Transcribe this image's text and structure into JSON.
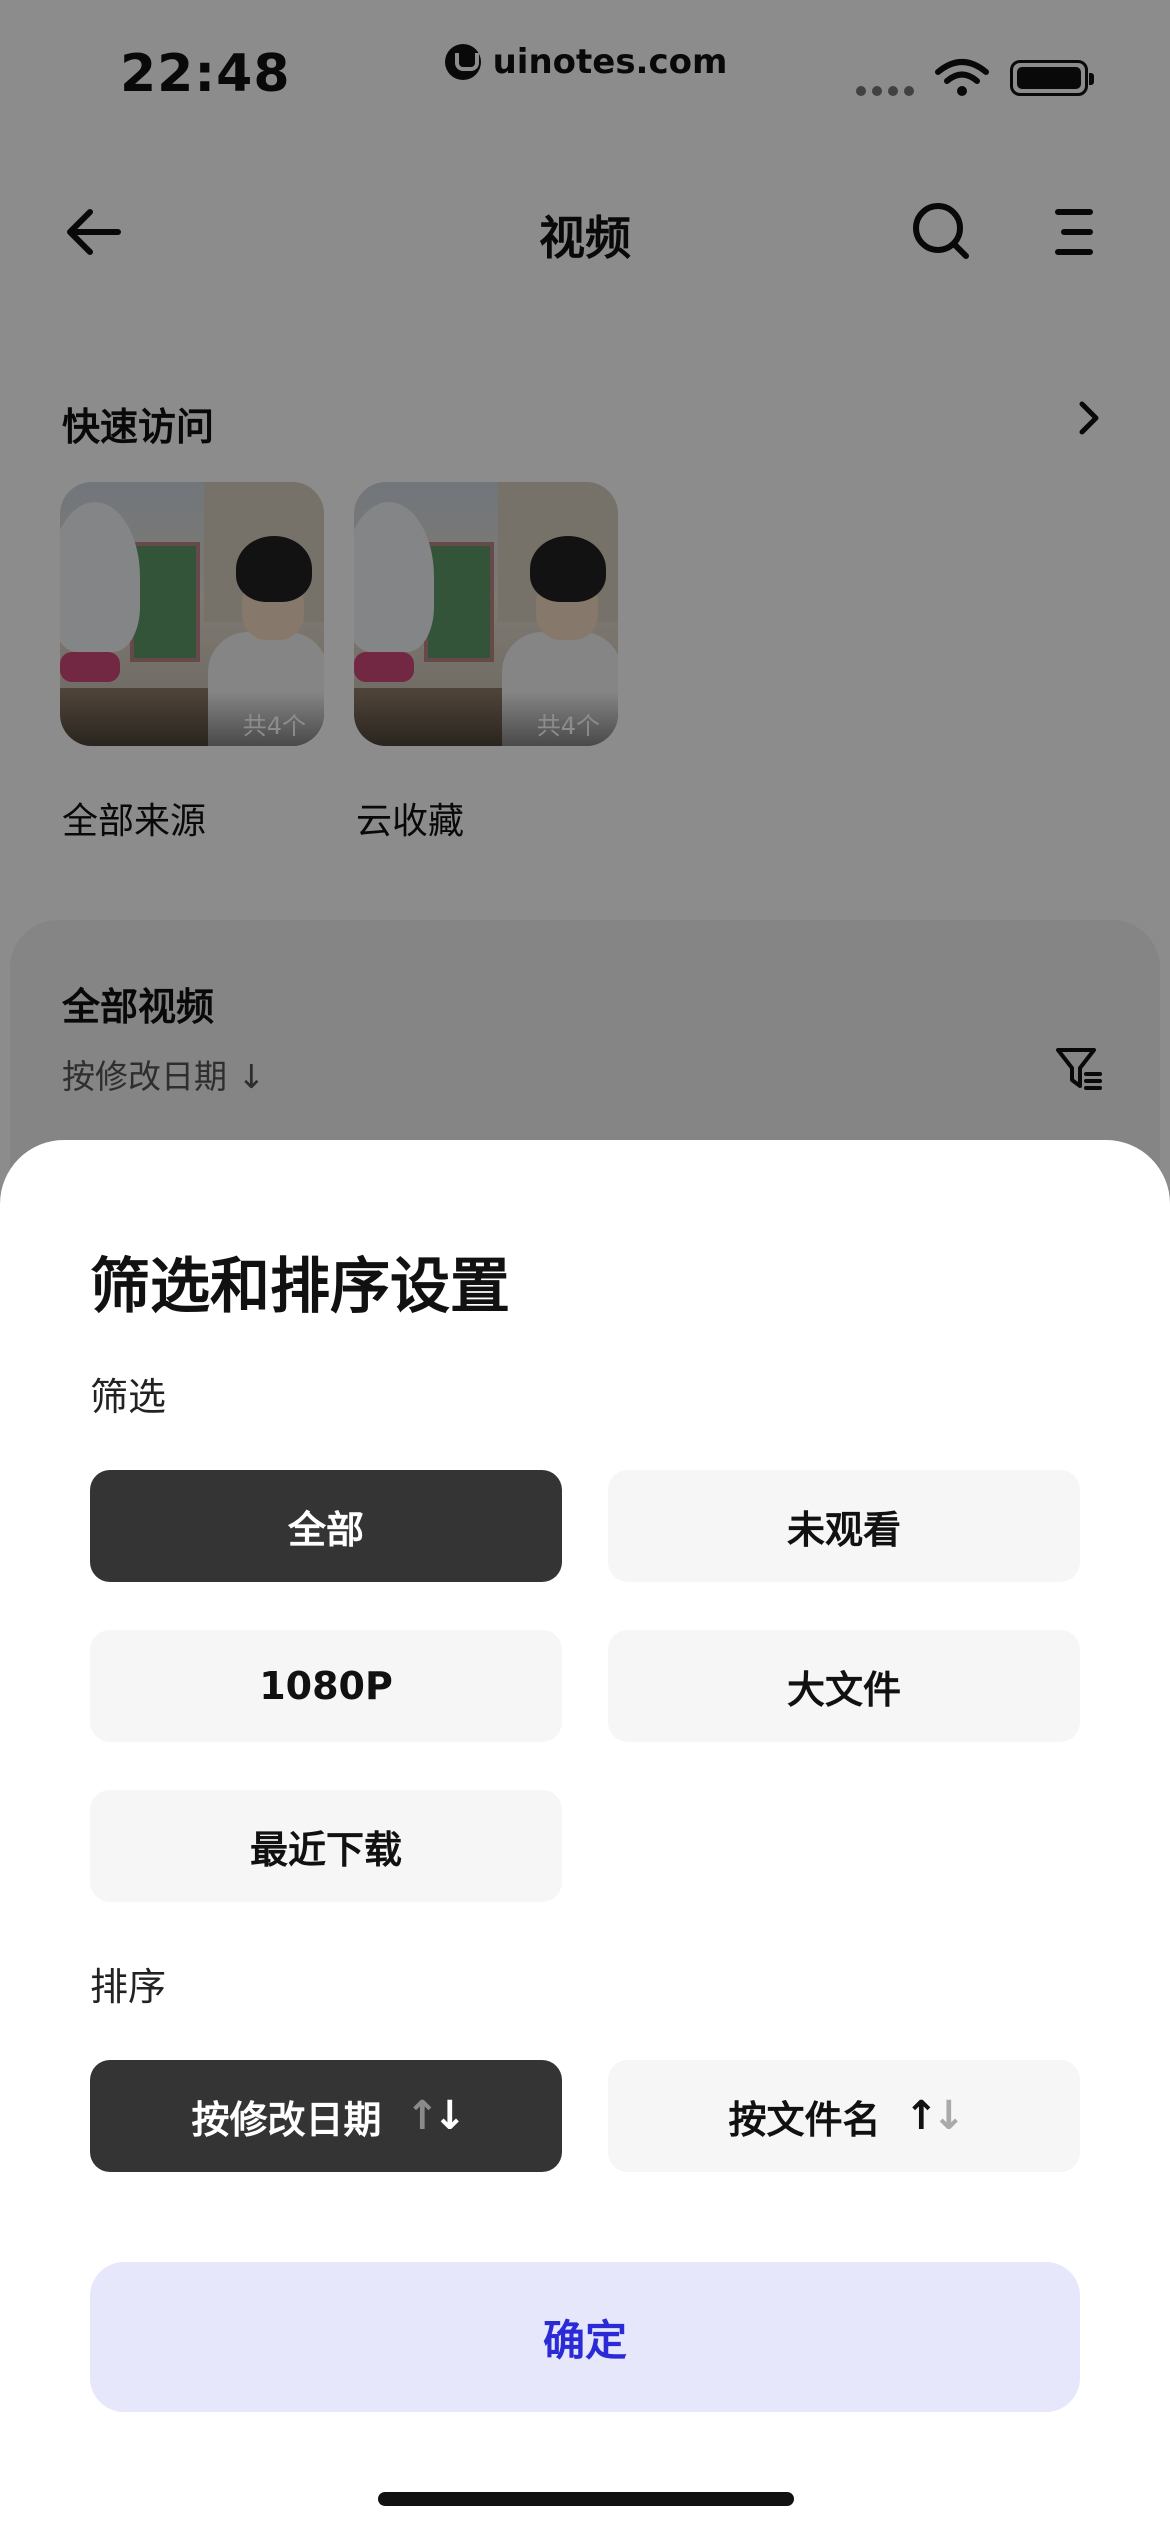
{
  "status_bar": {
    "time": "22:48",
    "site_badge": "uinotes.com"
  },
  "nav": {
    "title": "视频",
    "icons": [
      "back-arrow-icon",
      "search-icon",
      "menu-icon"
    ]
  },
  "quick_access": {
    "title": "快速访问",
    "items": [
      {
        "label": "全部来源",
        "count": "共4个"
      },
      {
        "label": "云收藏",
        "count": "共4个"
      }
    ]
  },
  "all_videos": {
    "title": "全部视频",
    "sort_label": "按修改日期 ↓"
  },
  "sheet": {
    "title": "筛选和排序设置",
    "filter_section": "筛选",
    "filters": [
      {
        "label": "全部",
        "selected": true
      },
      {
        "label": "未观看",
        "selected": false
      },
      {
        "label": "1080P",
        "selected": false
      },
      {
        "label": "大文件",
        "selected": false
      },
      {
        "label": "最近下载",
        "selected": false
      }
    ],
    "sort_section": "排序",
    "sorts": [
      {
        "label": "按修改日期",
        "selected": true
      },
      {
        "label": "按文件名",
        "selected": false
      }
    ],
    "confirm_label": "确定"
  },
  "colors": {
    "selected_bg": "#343434",
    "option_bg": "#f6f6f6",
    "confirm_bg": "#e6e7fb",
    "confirm_text": "#2a2ad6",
    "overlay": "rgba(0,0,0,0.45)"
  }
}
